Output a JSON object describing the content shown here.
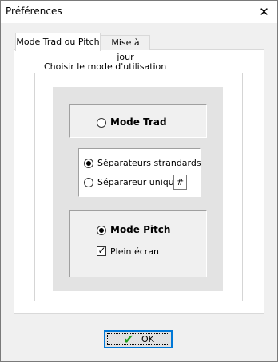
{
  "window": {
    "title": "Préférences",
    "close_glyph": "✕"
  },
  "tabs": [
    {
      "label": "Mode Trad ou Pitch",
      "selected": true
    },
    {
      "label": "Mise à jour",
      "selected": false
    }
  ],
  "group": {
    "legend": "Choisir le mode d'utilisation",
    "mode_trad": {
      "label": "Mode Trad",
      "selected": false
    },
    "separators": {
      "standard": {
        "label": "Séparateurs strandards",
        "selected": true
      },
      "unique": {
        "label": "Séparareur unique",
        "selected": false,
        "value": "#"
      }
    },
    "mode_pitch": {
      "label": "Mode Pitch",
      "selected": true
    },
    "fullscreen": {
      "label": "Plein écran",
      "checked": true
    }
  },
  "ok_button": {
    "label": "OK",
    "icon": "checkmark-icon",
    "icon_color": "#1e9e1e"
  },
  "colors": {
    "focus_border": "#0078d7",
    "face": "#f0f0f0",
    "panel_gray": "#e3e3e3"
  }
}
